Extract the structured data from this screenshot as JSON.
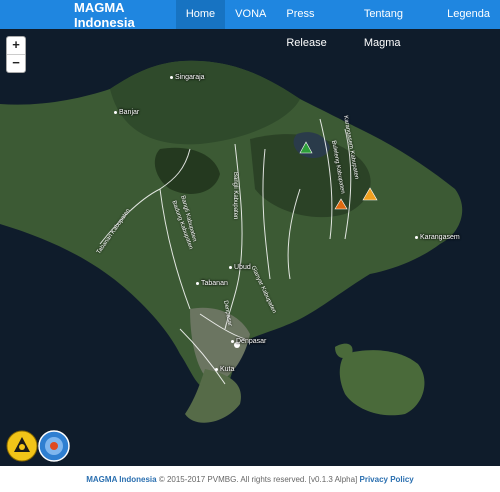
{
  "navbar": {
    "brand": "MAGMA Indonesia",
    "items": [
      {
        "label": "Home",
        "active": true
      },
      {
        "label": "VONA"
      },
      {
        "label": "Press Release"
      },
      {
        "label": "Tentang Magma"
      },
      {
        "label": "Legenda"
      }
    ]
  },
  "map": {
    "zoom_in": "+",
    "zoom_out": "−",
    "places": {
      "singaraja": "Singaraja",
      "banjar": "Banjar",
      "ubud": "Ubud",
      "tabanan": "Tabanan",
      "denpasar": "Denpasar",
      "kuta": "Kuta",
      "karangasem": "Karangasem"
    },
    "regions": {
      "jembrana": "Tabanan Kabupaten",
      "badung": "Badung Kabupaten",
      "bangli_a": "Bangli Kabupaten",
      "bangli_b": "Bangli Kabupaten",
      "gianyar": "Gianyar Kabupaten",
      "karangasem_kab": "Karangasem Kabupaten",
      "buleleng_kab": "Buleleng Kabupaten",
      "denpasar_kab": "Denpasar"
    },
    "volcano_colors": {
      "batur": "#2e9e3a",
      "agung": "#f0a020",
      "agung_outer": "#e06a10"
    }
  },
  "footer": {
    "brand": "MAGMA Indonesia",
    "text": " © 2015-2017 PVMBG. All rights reserved. [v0.1.3 Alpha] ",
    "privacy": "Privacy Policy"
  }
}
